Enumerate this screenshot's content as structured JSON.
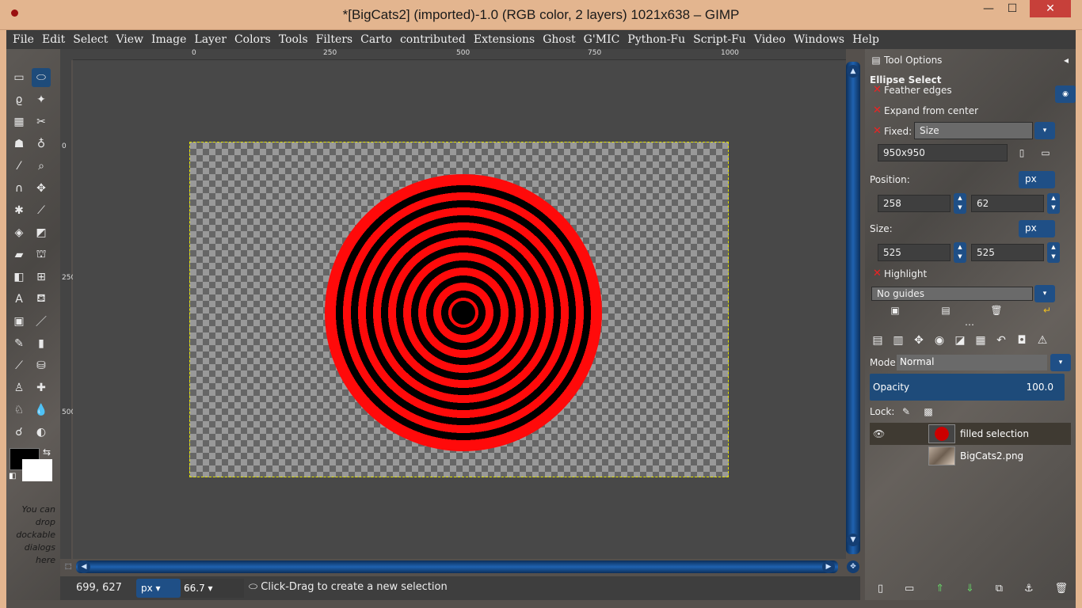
{
  "window": {
    "title": "*[BigCats2] (imported)-1.0 (RGB color, 2 layers) 1021x638 – GIMP",
    "minimize_label": "—",
    "maximize_label": "☐",
    "close_label": "✕"
  },
  "menu": [
    "File",
    "Edit",
    "Select",
    "View",
    "Image",
    "Layer",
    "Colors",
    "Tools",
    "Filters",
    "Carto",
    "contributed",
    "Extensions",
    "Ghost",
    "G'MIC",
    "Python-Fu",
    "Script-Fu",
    "Video",
    "Windows",
    "Help"
  ],
  "rulers": {
    "h_labels": [
      "0",
      "250",
      "500",
      "750",
      "1000"
    ],
    "v_labels": [
      "0",
      "250",
      "500"
    ]
  },
  "toolbox": {
    "dock_hint": "You can drop dockable dialogs here",
    "fg_color": "#000000",
    "bg_color": "#ffffff"
  },
  "statusbar": {
    "coords": "699, 627",
    "unit": "px",
    "zoom": "66.7",
    "message": "Click-Drag to create a new selection"
  },
  "tool_options": {
    "title": "Tool Options",
    "tool_name": "Ellipse Select",
    "feather_edges": "Feather edges",
    "expand_from_center": "Expand from center",
    "fixed_label": "Fixed:",
    "fixed_value": "Size",
    "fixed_size": "950x950",
    "position_label": "Position:",
    "position_unit": "px",
    "position_x": "258",
    "position_y": "62",
    "size_label": "Size:",
    "size_unit": "px",
    "size_w": "525",
    "size_h": "525",
    "highlight": "Highlight",
    "guides": "No guides"
  },
  "layers": {
    "mode_label": "Mode:",
    "mode_value": "Normal",
    "opacity_label": "Opacity",
    "opacity_value": "100.0",
    "lock_label": "Lock:",
    "items": [
      {
        "name": "filled selection"
      },
      {
        "name": "BigCats2.png"
      }
    ]
  }
}
